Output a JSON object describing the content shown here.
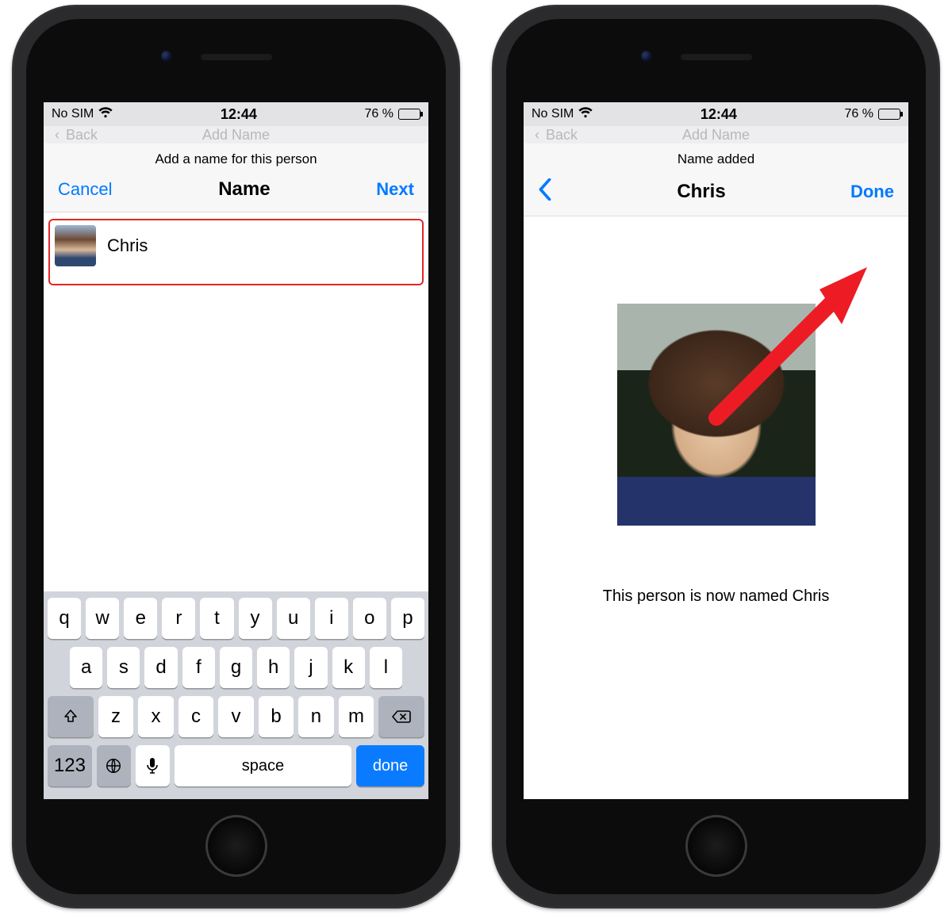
{
  "status": {
    "carrier": "No SIM",
    "time": "12:44",
    "battery_pct": "76 %"
  },
  "peek": {
    "back": "Back",
    "title": "Add Name"
  },
  "left": {
    "hint": "Add a name for this person",
    "cancel": "Cancel",
    "title": "Name",
    "next": "Next",
    "entered_name": "Chris"
  },
  "right": {
    "hint": "Name added",
    "title": "Chris",
    "done": "Done",
    "confirm": "This person is now named Chris"
  },
  "keyboard": {
    "row1": [
      "q",
      "w",
      "e",
      "r",
      "t",
      "y",
      "u",
      "i",
      "o",
      "p"
    ],
    "row2": [
      "a",
      "s",
      "d",
      "f",
      "g",
      "h",
      "j",
      "k",
      "l"
    ],
    "row3": [
      "z",
      "x",
      "c",
      "v",
      "b",
      "n",
      "m"
    ],
    "numkey": "123",
    "space": "space",
    "done": "done"
  }
}
